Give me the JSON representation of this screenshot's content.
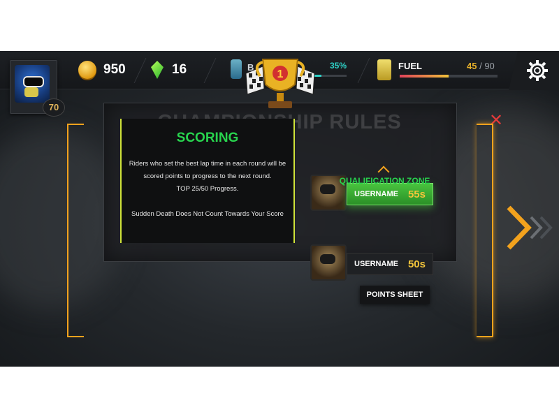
{
  "player": {
    "level": "70"
  },
  "currency": {
    "coins": "950",
    "gems": "16"
  },
  "boost": {
    "label": "B",
    "percent_label": "35%",
    "progress": 0.35
  },
  "fuel": {
    "label": "FUEL",
    "current": "45",
    "max": "90",
    "progress": 0.5
  },
  "trophy": {
    "rank": "1"
  },
  "page": {
    "title": "CHAMPIONSHIP RULES"
  },
  "scoring": {
    "title": "SCORING",
    "line1": "Riders who set the best lap time in each round will be scored points to progress to the next round.",
    "line2": "TOP 25/50 Progress.",
    "line3": "Sudden Death Does Not Count Towards Your Score"
  },
  "qualification": {
    "top_rider": {
      "name": "USERNAME",
      "time": "55s"
    },
    "zone_label": "QUALIFICATION ZONE",
    "bottom_rider": {
      "name": "USERNAME",
      "time": "50s"
    }
  },
  "buttons": {
    "points_sheet": "POINTS SHEET"
  },
  "colors": {
    "accent_orange": "#f3a21d",
    "accent_green": "#28d44e",
    "close_red": "#e23a3a"
  },
  "icons": [
    "coin-icon",
    "gem-icon",
    "boost-icon",
    "fuel-icon",
    "gear-icon",
    "trophy-icon",
    "close-icon",
    "next-arrow-icon"
  ]
}
